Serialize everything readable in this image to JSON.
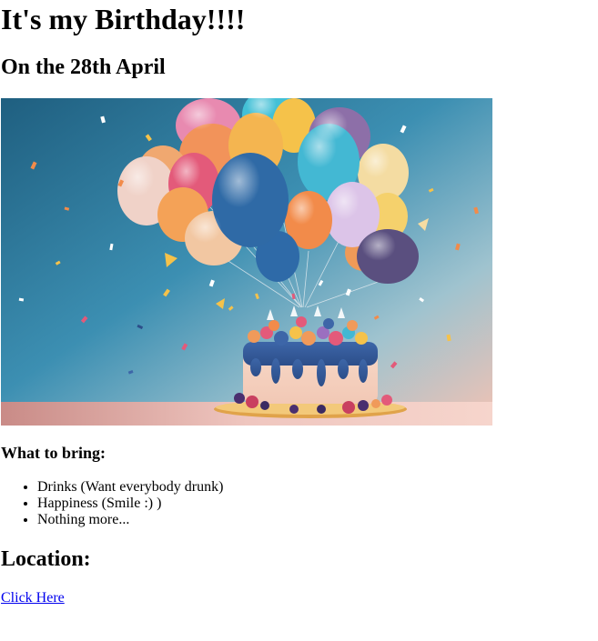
{
  "heading": "It's my Birthday!!!!",
  "date": "On the 28th April",
  "image": {
    "icon": "birthday-cake-balloons-image",
    "colors": {
      "bg_top": "#2d6e8f",
      "bg_mid": "#3f8fb0",
      "bg_warm": "#e8b3a6",
      "table": "#f0c7c0"
    }
  },
  "bring": {
    "title": "What to bring:",
    "items": [
      "Drinks (Want everybody drunk)",
      "Happiness (Smile :) )",
      "Nothing more..."
    ]
  },
  "location": {
    "title": "Location:",
    "link_text": "Click Here"
  }
}
